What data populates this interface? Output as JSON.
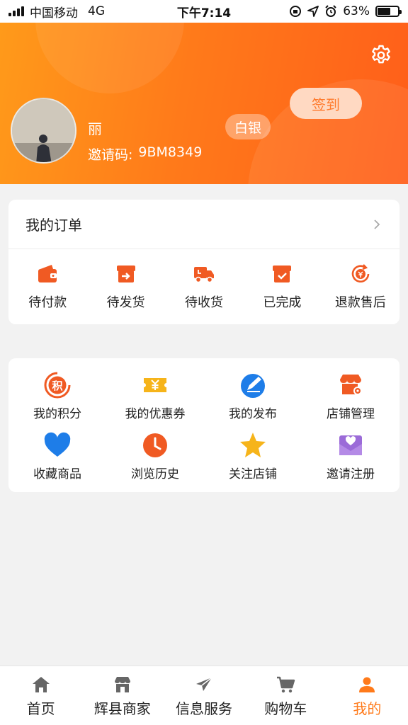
{
  "status_bar": {
    "carrier": "中国移动",
    "network": "4G",
    "time": "下午7:14",
    "battery": "63%",
    "battery_level": 0.63
  },
  "header": {
    "username": "丽",
    "invite_label": "邀请码:",
    "invite_code": "9BM8349",
    "level": "白银",
    "checkin_label": "签到",
    "settings_icon": "gear-icon"
  },
  "orders": {
    "title": "我的订单",
    "items": [
      {
        "label": "待付款",
        "icon": "wallet-icon"
      },
      {
        "label": "待发货",
        "icon": "box-send-icon"
      },
      {
        "label": "待收货",
        "icon": "truck-icon"
      },
      {
        "label": "已完成",
        "icon": "box-check-icon"
      },
      {
        "label": "退款售后",
        "icon": "refund-icon"
      }
    ]
  },
  "tools": {
    "items": [
      {
        "label": "我的积分",
        "icon": "points-icon"
      },
      {
        "label": "我的优惠券",
        "icon": "coupon-icon"
      },
      {
        "label": "我的发布",
        "icon": "publish-icon"
      },
      {
        "label": "店铺管理",
        "icon": "shop-manage-icon"
      },
      {
        "label": "收藏商品",
        "icon": "heart-icon"
      },
      {
        "label": "浏览历史",
        "icon": "clock-icon"
      },
      {
        "label": "关注店铺",
        "icon": "star-icon"
      },
      {
        "label": "邀请注册",
        "icon": "invite-mail-icon"
      }
    ]
  },
  "tabbar": {
    "items": [
      {
        "label": "首页",
        "icon": "home-icon"
      },
      {
        "label": "辉县商家",
        "icon": "store-icon"
      },
      {
        "label": "信息服务",
        "icon": "paper-plane-icon"
      },
      {
        "label": "购物车",
        "icon": "cart-icon"
      },
      {
        "label": "我的",
        "icon": "user-icon"
      }
    ],
    "active": "我的"
  },
  "colors": {
    "accent": "#ff7a1a",
    "header_start": "#ff9a1a",
    "header_end": "#ff5e1a",
    "icon_orange": "#f05a23",
    "heart_blue": "#1e7de8",
    "star_yellow": "#f6b41a",
    "invite_purple": "#9b6bd8"
  }
}
